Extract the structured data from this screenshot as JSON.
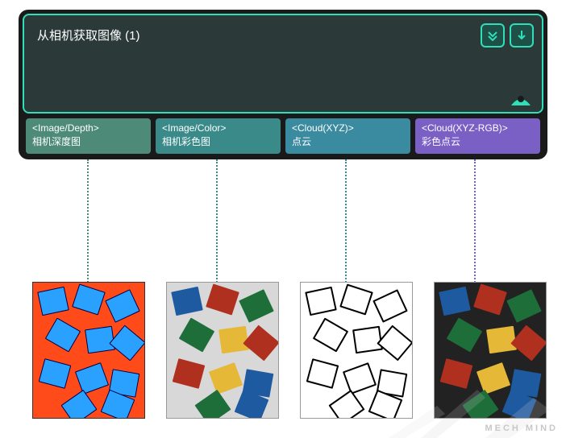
{
  "node": {
    "title": "从相机获取图像 (1)",
    "outputs": [
      {
        "type": "<Image/Depth>",
        "label": "相机深度图",
        "color": "#4d8a78"
      },
      {
        "type": "<Image/Color>",
        "label": "相机彩色图",
        "color": "#3a8a8a"
      },
      {
        "type": "<Cloud(XYZ)>",
        "label": "点云",
        "color": "#3a8aa0"
      },
      {
        "type": "<Cloud(XYZ-RGB)>",
        "label": "彩色点云",
        "color": "#7a5fc4"
      }
    ]
  },
  "watermark": "MECH MIND"
}
